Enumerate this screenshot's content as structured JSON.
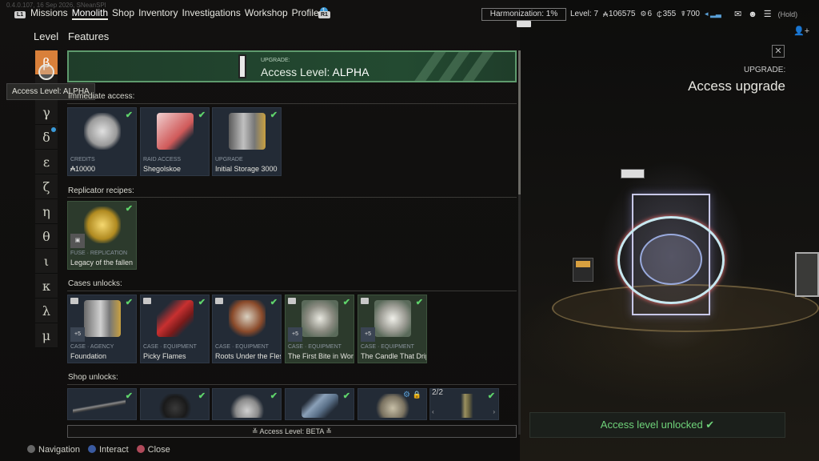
{
  "version": "0.4.0.107, 16 Sep 2026, SNeanSPl",
  "nav": {
    "l1": "L1",
    "r1": "R1",
    "items": [
      "Missions",
      "Monolith",
      "Shop",
      "Inventory",
      "Investigations",
      "Workshop",
      "Profile"
    ],
    "active": "Monolith",
    "profile_badge": "1"
  },
  "harmonization": "Harmonization: 1%",
  "stats": {
    "level": "Level: 7",
    "credits": "106575",
    "c2": "6",
    "c3": "355",
    "c4": "700"
  },
  "hold": "(Hold)",
  "columns": {
    "level": "Level",
    "features": "Features"
  },
  "levels": [
    "β",
    "α",
    "γ",
    "δ",
    "ε",
    "ζ",
    "η",
    "θ",
    "ι",
    "κ",
    "λ",
    "μ"
  ],
  "tooltip": "Access Level: ALPHA",
  "banner": {
    "eyebrow": "UPGRADE:",
    "prefix": "Access Level: ",
    "level": "ALPHA"
  },
  "sections": {
    "immediate": "Immediate access:",
    "recipes": "Replicator recipes:",
    "cases": "Cases unlocks:",
    "shop": "Shop unlocks:"
  },
  "immediate_cards": [
    {
      "cat": "CREDITS",
      "name": "₳10000"
    },
    {
      "cat": "RAID ACCESS",
      "name": "Shegolskoe"
    },
    {
      "cat": "UPGRADE",
      "name": "Initial Storage 3000"
    }
  ],
  "recipe_cards": [
    {
      "cat": "FUSE · REPLICATION",
      "name": "Legacy of the fallen"
    }
  ],
  "case_cards": [
    {
      "cat": "CASE · AGENCY",
      "name": "Foundation",
      "count": "+5"
    },
    {
      "cat": "CASE · EQUIPMENT",
      "name": "Picky Flames",
      "count": ""
    },
    {
      "cat": "CASE · EQUIPMENT",
      "name": "Roots Under the Flesh",
      "count": ""
    },
    {
      "cat": "CASE · EQUIPMENT",
      "name": "The First Bite in Worms",
      "count": "+5"
    },
    {
      "cat": "CASE · EQUIPMENT",
      "name": "The Candle That Drips",
      "count": "+5"
    }
  ],
  "shop_pager": "2/2",
  "bottom_bar": "≚ Access Level: BETA ≚",
  "hints": {
    "navigation": "Navigation",
    "interact": "Interact",
    "close": "Close"
  },
  "right_panel": {
    "close": "✕",
    "eyebrow": "UPGRADE:",
    "title": "Access upgrade",
    "status": "Access level unlocked ✔"
  },
  "colors": {
    "accent_orange": "#d9803a",
    "banner_green": "#234a31",
    "check_green": "#5fd46b",
    "card_blue": "#232b36",
    "card_green": "#2c3a2c"
  }
}
